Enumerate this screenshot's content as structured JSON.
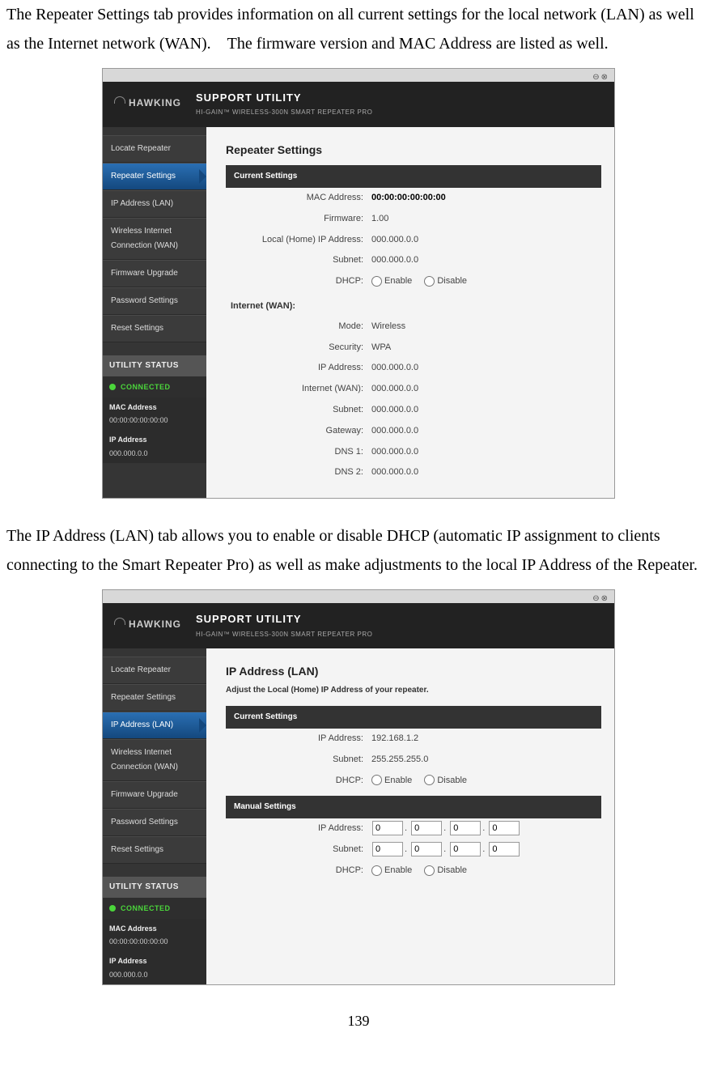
{
  "doc": {
    "para1": "The Repeater Settings tab provides information on all current settings for the local network (LAN) as well as the Internet network (WAN). The firmware version and MAC Address are listed as well.",
    "para2": "The IP Address (LAN) tab allows you to enable or disable DHCP (automatic IP assignment to clients connecting to the Smart Repeater Pro) as well as make adjustments to the local IP Address of the Repeater.",
    "page_number": "139"
  },
  "app": {
    "brand": "HAWKING",
    "title": "SUPPORT UTILITY",
    "subtitle": "HI-GAIN™ WIRELESS-300N SMART REPEATER PRO",
    "window_controls": "⊖⊗",
    "sidebar": {
      "items": [
        {
          "label": "Locate Repeater"
        },
        {
          "label": "Repeater Settings"
        },
        {
          "label": "IP Address (LAN)"
        },
        {
          "label": "Wireless Internet Connection (WAN)"
        },
        {
          "label": "Firmware Upgrade"
        },
        {
          "label": "Password Settings"
        },
        {
          "label": "Reset Settings"
        }
      ],
      "status": {
        "header": "UTILITY STATUS",
        "connected": "CONNECTED",
        "mac_label": "MAC Address",
        "mac_value": "00:00:00:00:00:00",
        "ip_label": "IP Address",
        "ip_value": "000.000.0.0"
      }
    }
  },
  "screen1": {
    "title": "Repeater Settings",
    "current_settings": "Current Settings",
    "rows": {
      "mac_k": "MAC Address:",
      "mac_v": "00:00:00:00:00:00",
      "fw_k": "Firmware:",
      "fw_v": "1.00",
      "localip_k": "Local (Home) IP Address:",
      "localip_v": "000.000.0.0",
      "subnet_k": "Subnet:",
      "subnet_v": "000.000.0.0",
      "dhcp_k": "DHCP:",
      "dhcp_enable": "Enable",
      "dhcp_disable": "Disable"
    },
    "wan_heading": "Internet (WAN):",
    "wan": {
      "mode_k": "Mode:",
      "mode_v": "Wireless",
      "sec_k": "Security:",
      "sec_v": "WPA",
      "ip_k": "IP Address:",
      "ip_v": "000.000.0.0",
      "iwan_k": "Internet (WAN):",
      "iwan_v": "000.000.0.0",
      "subnet_k": "Subnet:",
      "subnet_v": "000.000.0.0",
      "gw_k": "Gateway:",
      "gw_v": "000.000.0.0",
      "dns1_k": "DNS 1:",
      "dns1_v": "000.000.0.0",
      "dns2_k": "DNS 2:",
      "dns2_v": "000.000.0.0"
    }
  },
  "screen2": {
    "title": "IP Address (LAN)",
    "subtitle": "Adjust the Local (Home) IP Address of your repeater.",
    "current_settings": "Current Settings",
    "cur": {
      "ip_k": "IP Address:",
      "ip_v": "192.168.1.2",
      "subnet_k": "Subnet:",
      "subnet_v": "255.255.255.0",
      "dhcp_k": "DHCP:",
      "dhcp_enable": "Enable",
      "dhcp_disable": "Disable"
    },
    "manual_settings": "Manual Settings",
    "man": {
      "ip_k": "IP Address:",
      "ip_parts": [
        "0",
        "0",
        "0",
        "0"
      ],
      "subnet_k": "Subnet:",
      "subnet_parts": [
        "0",
        "0",
        "0",
        "0"
      ],
      "dhcp_k": "DHCP:",
      "dhcp_enable": "Enable",
      "dhcp_disable": "Disable"
    }
  }
}
